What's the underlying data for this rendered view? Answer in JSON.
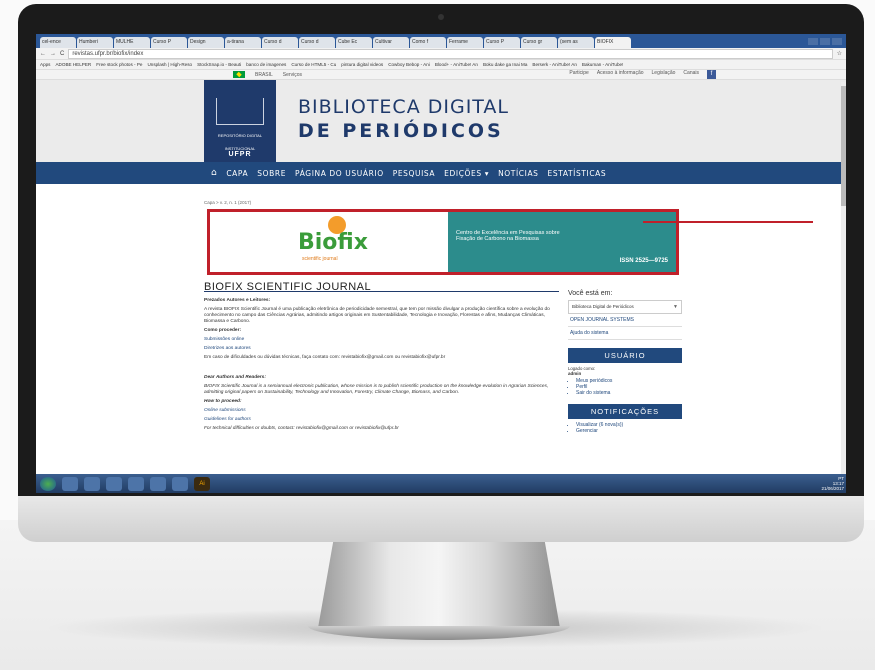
{
  "browser": {
    "tabs": [
      "cel-ence",
      "Humberi",
      "MULHE",
      "Curso P",
      "Design",
      "a-tirana",
      "Curso d",
      "Curso d",
      "Cube Ec",
      "Cultivar",
      "Como f",
      "Ferrame",
      "Curso P",
      "Curso gr",
      "(sem as",
      "BIOFIX"
    ],
    "url": "revistas.ufpr.br/biofix/index",
    "bookmarks": [
      "Apps",
      "ADOBE HELPER",
      "Free stock photos - Pe",
      "Unsplash | High-Reso",
      "StockSnap.io - Beauti",
      "banco de imagenes",
      "Curso de HTML5 - Cu",
      "pintura digital videos",
      "Cowboy Bebop - Ani",
      "Blood+ - AniTube! An",
      "Boku dake ga Inai Ma",
      "Berserk - AniTube! An",
      "Bakuman - AniTube!"
    ]
  },
  "govbar": {
    "country": "BRASIL",
    "services": "Serviços",
    "links": [
      "Participe",
      "Acesso à informação",
      "Legislação",
      "Canais"
    ]
  },
  "header": {
    "logo_line1": "REPOSITÓRIO DIGITAL",
    "logo_line2": "INSTITUCIONAL",
    "logo_line3": "UFPR",
    "title_line1": "BIBLIOTECA DIGITAL",
    "title_line2": "DE PERIÓDICOS"
  },
  "nav": [
    "CAPA",
    "SOBRE",
    "PÁGINA DO USUÁRIO",
    "PESQUISA",
    "EDIÇÕES ▾",
    "NOTÍCIAS",
    "ESTATÍSTICAS"
  ],
  "breadcrumb": "Capa > v. 2, n. 1 (2017)",
  "banner": {
    "logo": "Biofix",
    "logo_sub": "scientific journal",
    "tagline1": "Centro de Excelência em Pesquisas sobre",
    "tagline2": "Fixação de Carbono na Biomassa",
    "issn": "ISSN 2525—9725"
  },
  "main": {
    "title": "BIOFIX SCIENTIFIC JOURNAL",
    "pt_greeting": "Prezados Autores e Leitores:",
    "pt_body": "A revista BIOFIX Scientific Journal é uma publicação eletrônica de periodicidade semestral, que tem por missão divulgar a produção científica sobre a evolução do conhecimento no campo das Ciências Agrárias, admitindo artigos originais em Sustentabilidade, Tecnologia e Inovação, Florestas e afins, Mudanças Climáticas, Biomassa e Carbono.",
    "pt_how": "Como proceder:",
    "pt_link1": "Submissões online",
    "pt_link2": "Diretrizes aos autores",
    "pt_contact": "Em caso de dificuldades ou dúvidas técnicas, faça contato com: revistabiofix@gmail.com ou revistabiofix@ufpr.br",
    "en_greeting": "Dear Authors and Readers:",
    "en_body": "BIOFIX Scientific Journal is a semiannual electronic publication, whose mission is to publish scientific production on the knowledge evolution in Agrarian Sciences, admitting original papers on Sustainability, Technology and Innovation, Forestry, Climate Change, Biomass, and Carbon.",
    "en_how": "How to proceed:",
    "en_link1": "Online submissions",
    "en_link2": "Guidelines for authors",
    "en_contact": "For technical difficulties or doubts, contact: revistabiofix@gmail.com or revistabiofix@ufpr.br"
  },
  "sidebar": {
    "location_label": "Você está em:",
    "location_value": "Biblioteca Digital de Periódicos",
    "ojs": "OPEN JOURNAL SYSTEMS",
    "help": "Ajuda do sistema",
    "user_header": "USUÁRIO",
    "logged_as": "Logado como:",
    "user": "admin",
    "user_links": [
      "Meus periódicos",
      "Perfil",
      "Sair do sistema"
    ],
    "notif_header": "NOTIFICAÇÕES",
    "notif_links": [
      "Visualizar (6 nova(s))",
      "Gerenciar"
    ]
  },
  "taskbar": {
    "ai_label": "Ai",
    "tray_lang": "PT",
    "time": "13:17",
    "date": "21/06/2017"
  }
}
